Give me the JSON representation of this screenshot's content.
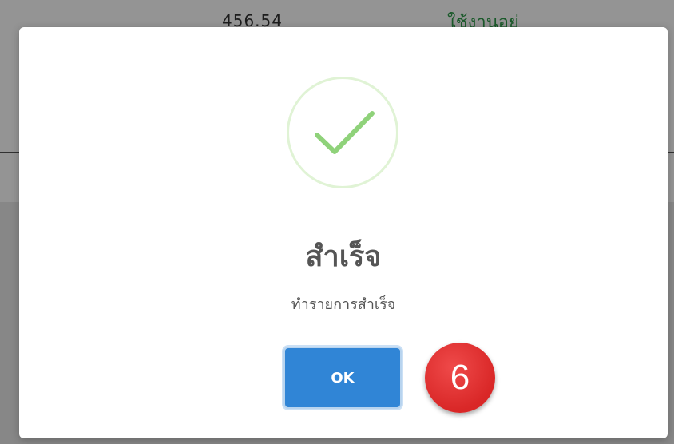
{
  "background": {
    "value_text": "456.54",
    "status_text": "ใช้งานอยู่"
  },
  "dialog": {
    "icon": "success-check-icon",
    "title": "สำเร็จ",
    "message": "ทำรายการสำเร็จ",
    "ok_label": "OK",
    "step_badge": "6"
  },
  "colors": {
    "confirm_button": "#3085d6",
    "check_mark": "#8fd27a",
    "step_badge": "#e03131",
    "title_text": "#555555"
  }
}
